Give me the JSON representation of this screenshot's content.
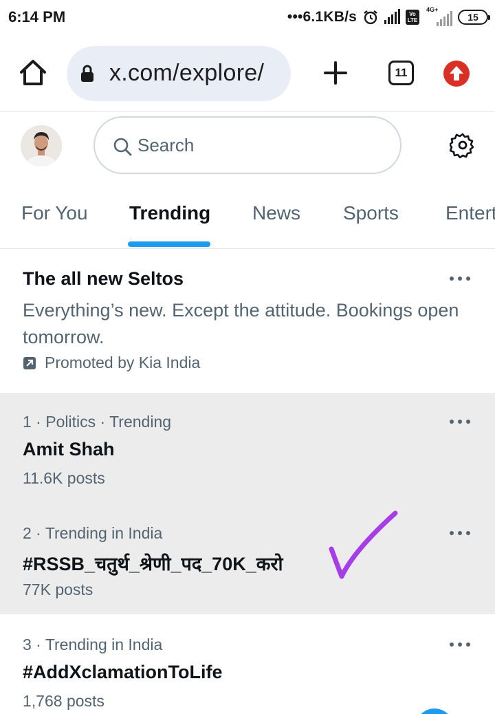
{
  "status_bar": {
    "time": "6:14 PM",
    "network_speed": "6.1KB/s",
    "network_type": "4G+",
    "volte": "Vo LTE",
    "battery": "15",
    "icons": [
      "alarm-icon",
      "signal-icon",
      "volte-icon",
      "signal-icon-faded",
      "battery-icon"
    ]
  },
  "browser": {
    "url": "x.com/explore/",
    "tab_count": "11",
    "icons": [
      "home-icon",
      "lock-icon",
      "plus-icon",
      "tabs-icon",
      "update-icon"
    ],
    "update_color": "#d93025"
  },
  "header": {
    "search_placeholder": "Search",
    "icons": [
      "avatar",
      "search-icon",
      "gear-icon"
    ]
  },
  "tabs": [
    "For You",
    "Trending",
    "News",
    "Sports",
    "Entert"
  ],
  "active_tab": "Trending",
  "accent_color": "#1d9bf0",
  "promoted": {
    "title": "The all new Seltos",
    "description": "Everything’s new. Except the attitude. Bookings open tomorrow.",
    "promoted_by": "Promoted by Kia India"
  },
  "trends": [
    {
      "meta": "1 · Politics · Trending",
      "name": "Amit Shah",
      "posts": "11.6K posts",
      "highlighted": true
    },
    {
      "meta": "2 · Trending in India",
      "name": "#RSSB_चतुर्थ_श्रेणी_पद_70K_करो",
      "posts": "77K posts",
      "highlighted": true
    },
    {
      "meta": "3 · Trending in India",
      "name": "#AddXclamationToLife",
      "posts": "1,768 posts",
      "highlighted": false
    }
  ],
  "annotation": {
    "mark": "checkmark",
    "color": "#a53ee6"
  }
}
